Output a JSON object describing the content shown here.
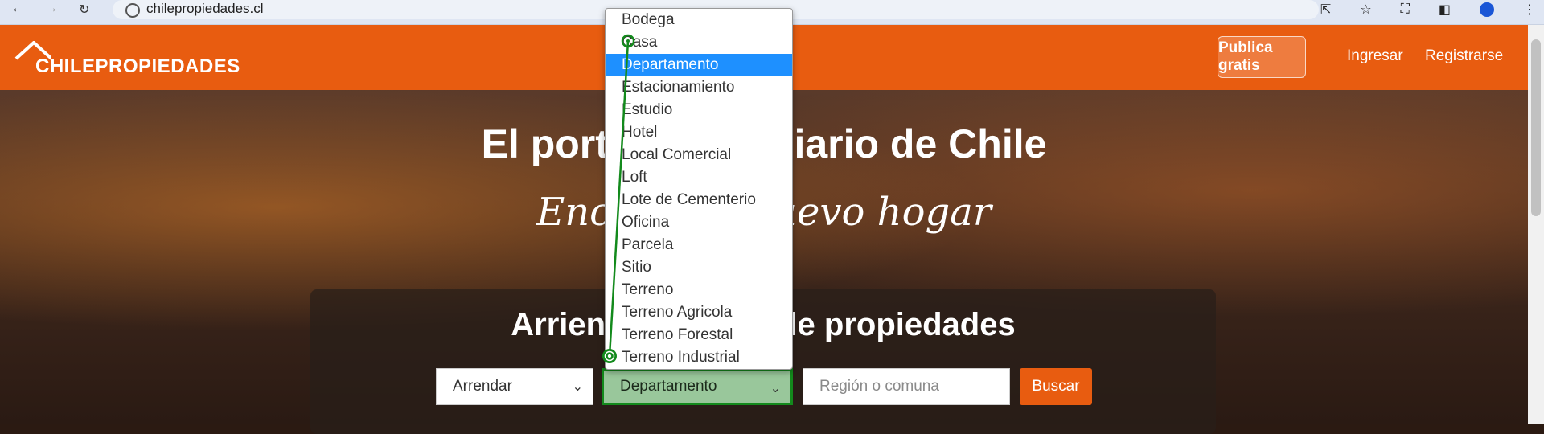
{
  "browser": {
    "url": "chilepropiedades.cl"
  },
  "header": {
    "logo_text_light": "CHILE",
    "logo_text_bold": "PROPIEDADES",
    "publish_button": "Publica gratis",
    "login_link": "Ingresar",
    "register_link": "Registrarse"
  },
  "hero": {
    "title_left": "El port",
    "title_right": "diario de Chile",
    "subtitle_left": "Enc",
    "subtitle_right": "uevo hogar",
    "search_heading_left": "Arrien",
    "search_heading_right": "de propiedades"
  },
  "search": {
    "operation_value": "Arrendar",
    "type_value": "Departamento",
    "location_placeholder": "Región o comuna",
    "search_button": "Buscar"
  },
  "dropdown": {
    "options": [
      "Bodega",
      "Casa",
      "Departamento",
      "Estacionamiento",
      "Estudio",
      "Hotel",
      "Local Comercial",
      "Loft",
      "Lote de Cementerio",
      "Oficina",
      "Parcela",
      "Sitio",
      "Terreno",
      "Terreno Agricola",
      "Terreno Forestal",
      "Terreno Industrial"
    ],
    "highlighted": "Departamento"
  },
  "colors": {
    "brand": "#e85c10",
    "highlight": "#1e90ff",
    "annotation": "#138a1c"
  }
}
